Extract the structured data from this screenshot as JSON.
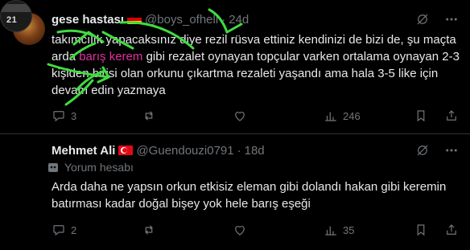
{
  "posts": [
    {
      "name": "gese hastası",
      "handle": "@boys_ofhell",
      "time": "24d",
      "text_before": "takımcılık yapacaksınız diye rezil rüsva ettiniz kendinizi de bizi de, şu maçta arda ",
      "mention": "barış kerem",
      "text_after": " gibi rezalet oynayan topçular varken ortalama oynayan 2-3 kişiden birisi olan orkunu çıkartma rezaleti yaşandı ama hala 3-5 like için devam edin yazmaya",
      "replies": "3",
      "views": "246",
      "flag": "germany"
    },
    {
      "name": "Mehmet Ali",
      "handle": "@Guendouzi0791",
      "time": "18d",
      "badge": "Yorum hesabı",
      "text": "Arda daha ne yapsın orkun etkisiz eleman gibi dolandı hakan gibi keremin batırması kadar doğal bişey yok hele barış eşeği",
      "replies": "2",
      "views": "35",
      "flag": "turkey",
      "avatar_text": "21"
    }
  ],
  "colors": {
    "accent_mention": "#e0309c",
    "muted": "#71767b",
    "scribble": "#3fdc3f"
  }
}
